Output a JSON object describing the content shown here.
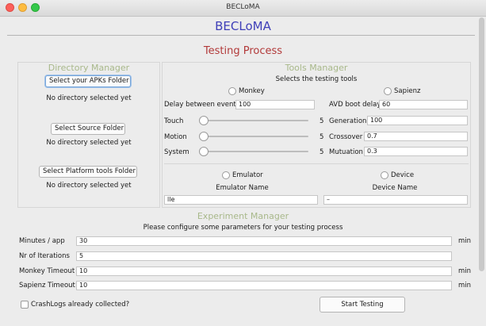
{
  "window": {
    "title": "BECLoMA"
  },
  "app": {
    "title": "BECLoMA",
    "section_title": "Testing Process"
  },
  "directory_manager": {
    "title": "Directory Manager",
    "apks_button": "Select your APKs Folder",
    "apks_status": "No directory selected yet",
    "source_button": "Select Source Folder",
    "source_status": "No directory selected yet",
    "platform_button": "Select Platform tools Folder",
    "platform_status": "No directory selected yet"
  },
  "tools_manager": {
    "title": "Tools Manager",
    "subtitle": "Selects the testing tools",
    "monkey_label": "Monkey",
    "sapienz_label": "Sapienz",
    "delay_label": "Delay between events",
    "delay_value": "100",
    "avd_label": "AVD boot delay",
    "avd_value": "60",
    "touch_label": "Touch",
    "touch_value": "5",
    "motion_label": "Motion",
    "motion_value": "5",
    "system_label": "System",
    "system_value": "5",
    "generation_label": "Generation",
    "generation_value": "100",
    "crossover_label": "Crossover",
    "crossover_value": "0.7",
    "mutation_label": "Mutuation",
    "mutation_value": "0.3",
    "emulator_label": "Emulator",
    "device_label": "Device",
    "emulator_name_label": "Emulator Name",
    "device_name_label": "Device Name",
    "emulator_name_value": "lle",
    "device_name_value": "–"
  },
  "experiment_manager": {
    "title": "Experiment Manager",
    "subtitle": "Please configure some parameters for your testing process",
    "minutes_label": "Minutes / app",
    "minutes_value": "30",
    "minutes_unit": "min",
    "iterations_label": "Nr of Iterations",
    "iterations_value": "5",
    "monkey_timeout_label": "Monkey Timeout",
    "monkey_timeout_value": "10",
    "monkey_timeout_unit": "min",
    "sapienz_timeout_label": "Sapienz Timeout",
    "sapienz_timeout_value": "10",
    "sapienz_timeout_unit": "min",
    "crashlogs_label": "CrashLogs already collected?",
    "start_button": "Start Testing"
  },
  "colors": {
    "app_title": "#3f3fb8",
    "section_title": "#b23a3a",
    "group_title": "#a8b88a"
  },
  "icons": [
    "close-window-icon",
    "minimize-window-icon",
    "zoom-window-icon"
  ]
}
